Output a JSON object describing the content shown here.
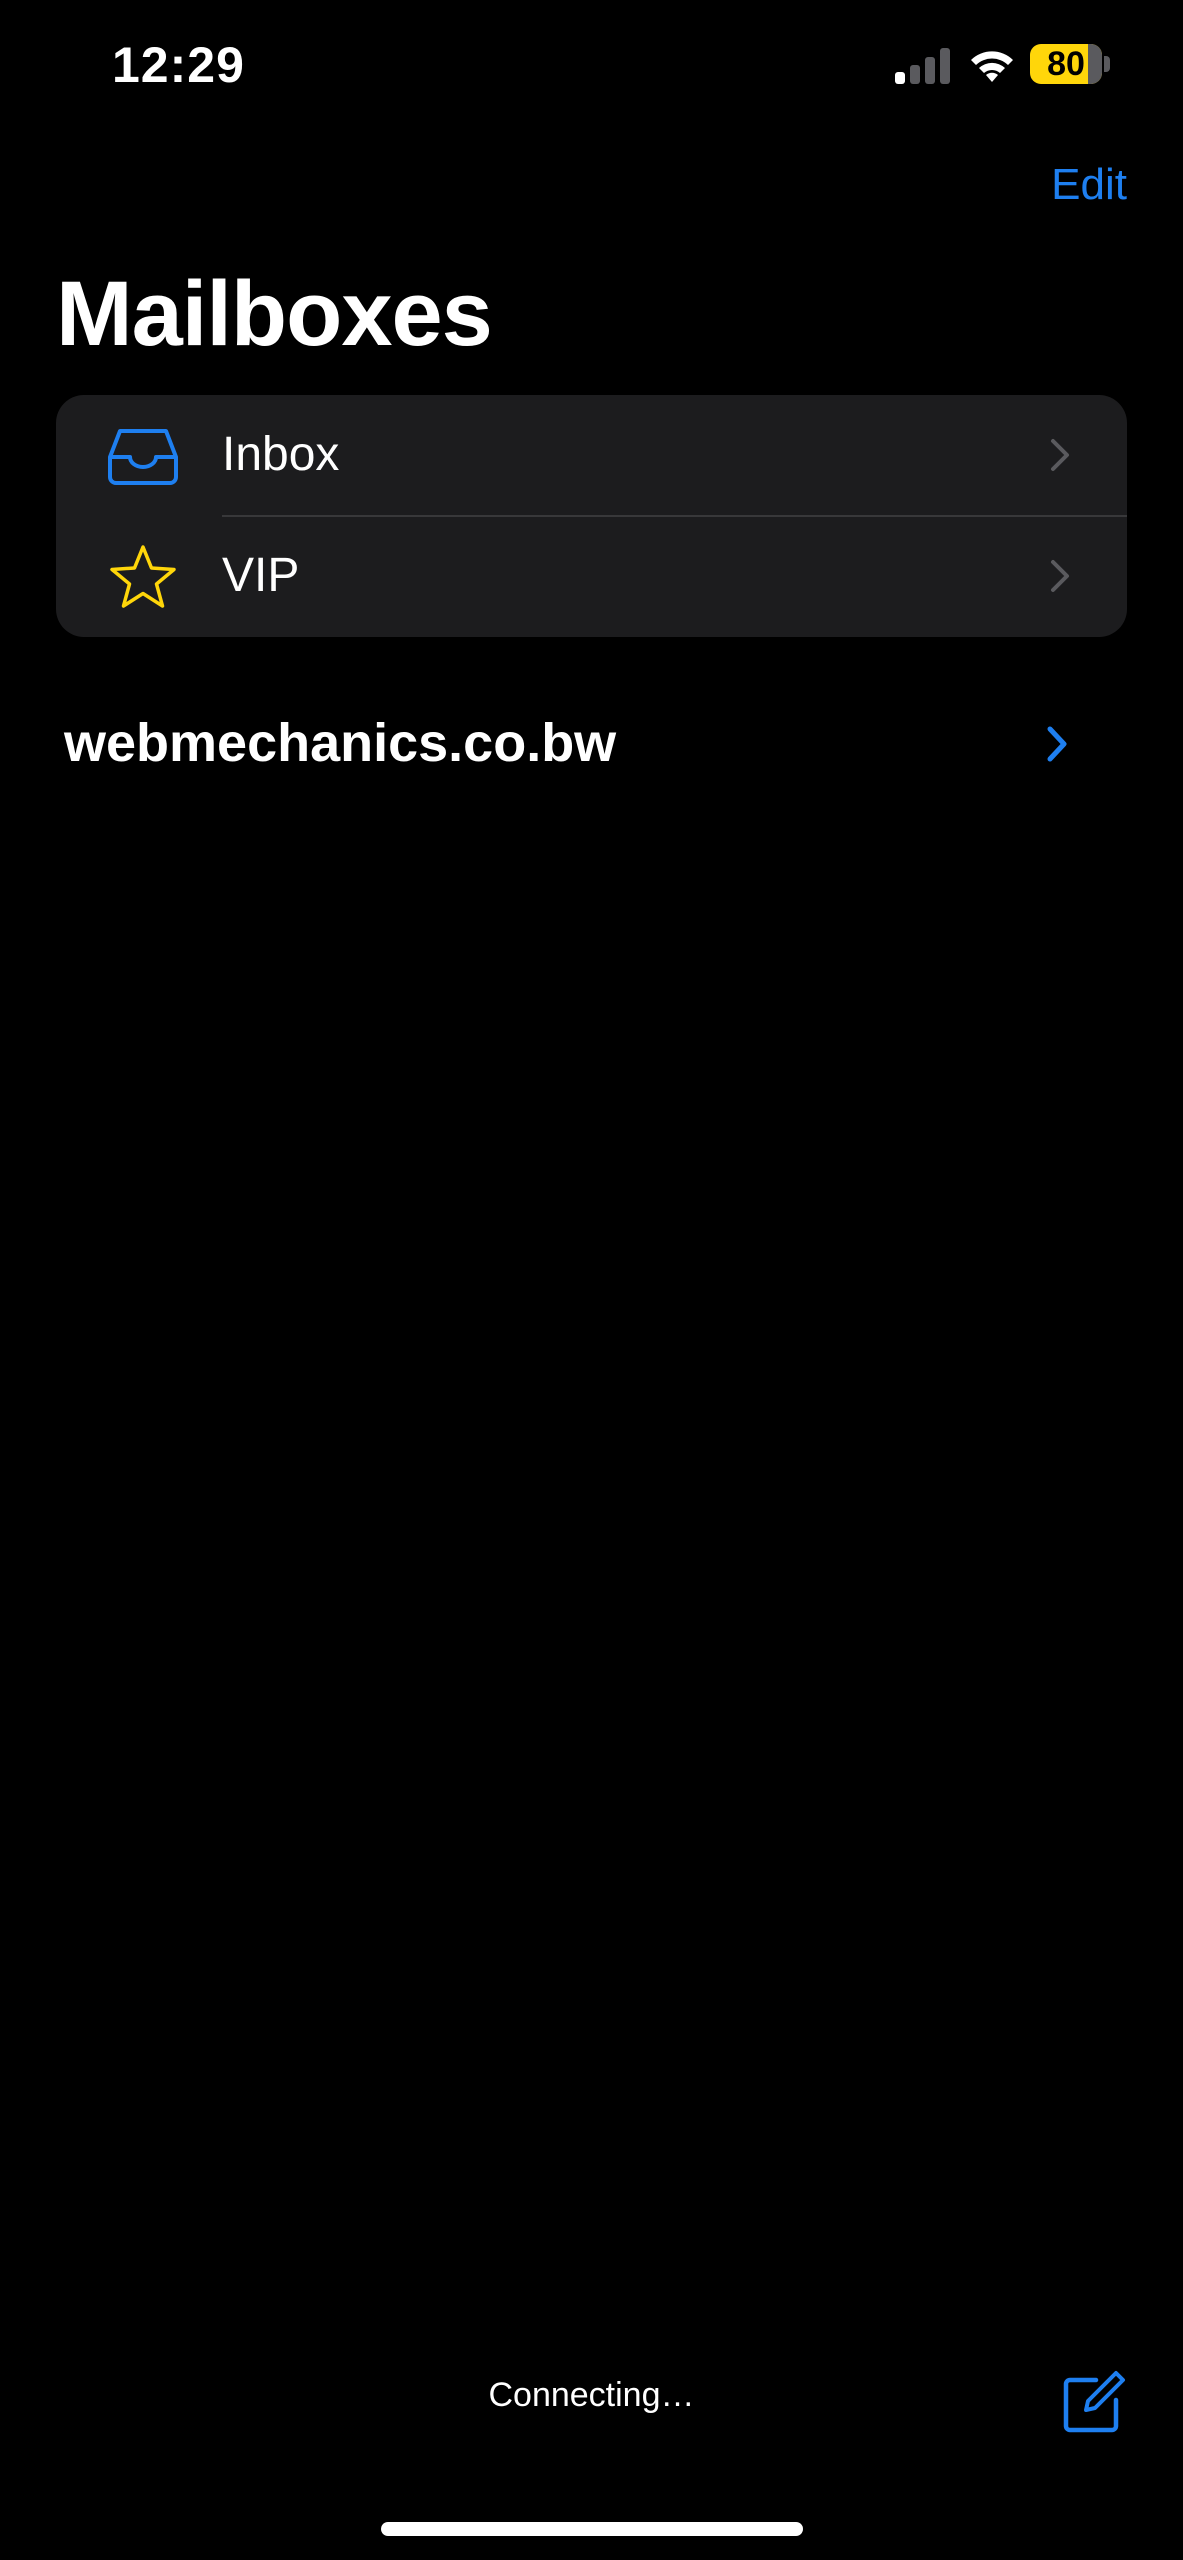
{
  "status_bar": {
    "time": "12:29",
    "battery_percent": 80,
    "battery_label": "80",
    "battery_color": "#ffd60a",
    "signal_bars_active": 1,
    "signal_bars_total": 4
  },
  "nav": {
    "edit_label": "Edit",
    "title": "Mailboxes"
  },
  "mailboxes": [
    {
      "label": "Inbox",
      "icon": "tray-icon",
      "icon_color": "#1e7ff0"
    },
    {
      "label": "VIP",
      "icon": "star-icon",
      "icon_color": "#ffd60a"
    }
  ],
  "account": {
    "name": "webmechanics.co.bw"
  },
  "toolbar": {
    "status": "Connecting…",
    "compose_icon": "compose-icon"
  },
  "colors": {
    "accent": "#1e7ff0",
    "background": "#000000",
    "group_background": "#1c1c1e"
  }
}
